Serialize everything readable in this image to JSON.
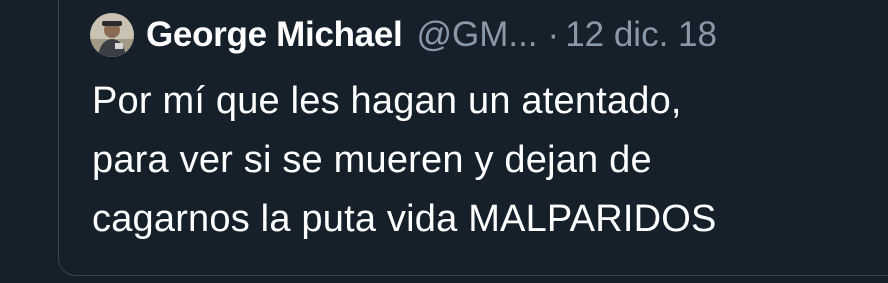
{
  "tweet": {
    "author_name": "George Michael",
    "author_handle": "@GM...",
    "separator": "·",
    "date": "12 dic. 18",
    "lines": [
      "Por mí que les hagan un atentado,",
      "para ver si se mueren y dejan de",
      "cagarnos la puta vida MALPARIDOS"
    ]
  },
  "colors": {
    "background": "#15202b",
    "border": "#38444d",
    "text": "#ffffff",
    "muted": "#8b98a5"
  },
  "icons": {
    "avatar": "user-avatar"
  }
}
